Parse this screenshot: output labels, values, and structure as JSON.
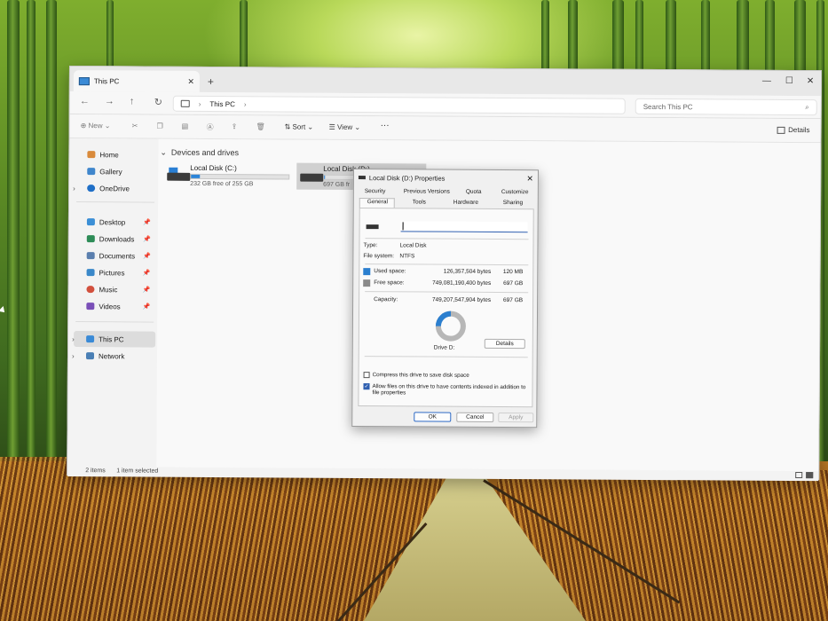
{
  "colors": {
    "accent": "#2b84d8",
    "selection": "#d0d0d0",
    "used_space": "#2b7fcf",
    "free_space": "#8a8a8a",
    "window_bg": "#f3f3f3"
  },
  "explorer": {
    "tab_title": "This PC",
    "address": {
      "location": "This PC"
    },
    "search_placeholder": "Search This PC",
    "toolbar": {
      "new_label": "New",
      "sort_label": "Sort",
      "view_label": "View",
      "more_label": "···",
      "details_label": "Details"
    },
    "nav": {
      "home": "Home",
      "gallery": "Gallery",
      "onedrive": "OneDrive",
      "desktop": "Desktop",
      "downloads": "Downloads",
      "documents": "Documents",
      "pictures": "Pictures",
      "music": "Music",
      "videos": "Videos",
      "thispc": "This PC",
      "network": "Network"
    },
    "section_title": "Devices and drives",
    "drives": [
      {
        "name": "Local Disk (C:)",
        "free": "232 GB free of 255 GB",
        "used_fraction": 0.09
      },
      {
        "name": "Local Disk (D:)",
        "free": "697 GB fr",
        "used_fraction": 0.002
      }
    ],
    "status": {
      "items": "2 items",
      "selected": "1 item selected"
    }
  },
  "dialog": {
    "title": "Local Disk (D:) Properties",
    "tabs_row1": [
      "Security",
      "Previous Versions",
      "Quota",
      "Customize"
    ],
    "tabs_row2": [
      "General",
      "Tools",
      "Hardware",
      "Sharing"
    ],
    "name_value": "",
    "type_label": "Type:",
    "type_value": "Local Disk",
    "fs_label": "File system:",
    "fs_value": "NTFS",
    "used_label": "Used space:",
    "used_bytes": "126,357,504 bytes",
    "used_size": "120 MB",
    "free_label": "Free space:",
    "free_bytes": "749,081,190,400 bytes",
    "free_size": "697 GB",
    "capacity_label": "Capacity:",
    "capacity_bytes": "749,207,547,904 bytes",
    "capacity_size": "697 GB",
    "drive_label": "Drive D:",
    "details_button": "Details",
    "compress_label": "Compress this drive to save disk space",
    "index_label": "Allow files on this drive to have contents indexed in addition to file properties",
    "compress_checked": false,
    "index_checked": true,
    "ok": "OK",
    "cancel": "Cancel",
    "apply": "Apply"
  }
}
